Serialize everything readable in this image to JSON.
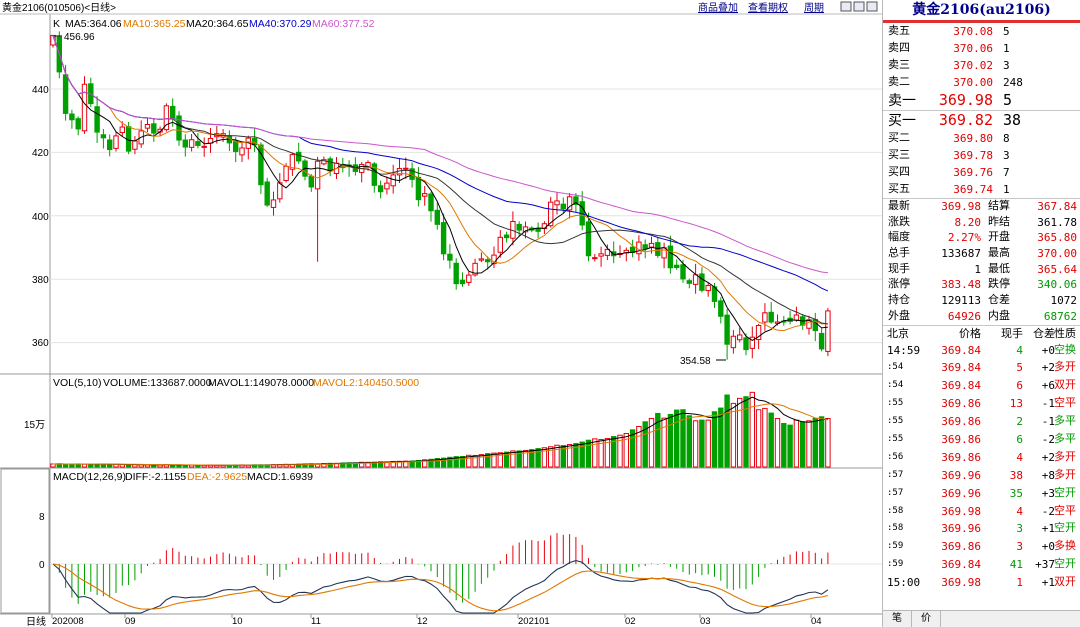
{
  "chart_header": {
    "title": "黄金2106",
    "code": "(010506)",
    "period": "<日线>",
    "links": [
      "商品叠加",
      "查看期权",
      "周期"
    ]
  },
  "ma_legend": [
    {
      "label": "MA5:364.06",
      "color": "#000000"
    },
    {
      "label": "MA10:365.25",
      "color": "#e07800"
    },
    {
      "label": "MA20:364.65",
      "color": "#000000"
    },
    {
      "label": "MA40:370.29",
      "color": "#0000cc"
    },
    {
      "label": "MA60:377.52",
      "color": "#cc55cc"
    }
  ],
  "price_pane": {
    "y_ticks": [
      "440",
      "420",
      "400",
      "380",
      "360"
    ],
    "high_label": "456.96",
    "low_label": "354.58"
  },
  "vol_pane": {
    "legend_vol": "VOL(5,10)",
    "legend_volume": "VOLUME:133687.0000",
    "legend_mavol1": "MAVOL1:149078.0000",
    "legend_mavol2": "MAVOL2:140450.5000",
    "y_tick": "15万"
  },
  "macd_pane": {
    "legend_macd": "MACD(12,26,9)",
    "legend_diff": "DIFF:-2.1155",
    "legend_dea": "DEA:-2.9625",
    "legend_hist": "MACD:1.6939",
    "y_ticks": [
      "8",
      "0"
    ]
  },
  "x_axis": {
    "period_label": "日线",
    "labels": [
      "202008",
      "09",
      "10",
      "11",
      "12",
      "202101",
      "02",
      "03",
      "04"
    ]
  },
  "quote": {
    "title": "黄金2106(au2106)",
    "asks": [
      {
        "label": "卖五",
        "price": "370.08",
        "vol": "5"
      },
      {
        "label": "卖四",
        "price": "370.06",
        "vol": "1"
      },
      {
        "label": "卖三",
        "price": "370.02",
        "vol": "3"
      },
      {
        "label": "卖二",
        "price": "370.00",
        "vol": "248"
      }
    ],
    "ask1": {
      "label": "卖一",
      "price": "369.98",
      "vol": "5"
    },
    "bid1": {
      "label": "买一",
      "price": "369.82",
      "vol": "38"
    },
    "bids": [
      {
        "label": "买二",
        "price": "369.80",
        "vol": "8"
      },
      {
        "label": "买三",
        "price": "369.78",
        "vol": "3"
      },
      {
        "label": "买四",
        "price": "369.76",
        "vol": "7"
      },
      {
        "label": "买五",
        "price": "369.74",
        "vol": "1"
      }
    ],
    "stats": [
      {
        "l1": "最新",
        "v1": "369.98",
        "c1": "red",
        "l2": "结算",
        "v2": "367.84",
        "c2": "red"
      },
      {
        "l1": "涨跌",
        "v1": "8.20",
        "c1": "red",
        "l2": "昨结",
        "v2": "361.78",
        "c2": "blk"
      },
      {
        "l1": "幅度",
        "v1": "2.27%",
        "c1": "red",
        "l2": "开盘",
        "v2": "365.80",
        "c2": "red"
      },
      {
        "l1": "总手",
        "v1": "133687",
        "c1": "blk",
        "l2": "最高",
        "v2": "370.00",
        "c2": "red"
      },
      {
        "l1": "现手",
        "v1": "1",
        "c1": "blk",
        "l2": "最低",
        "v2": "365.64",
        "c2": "red"
      },
      {
        "l1": "涨停",
        "v1": "383.48",
        "c1": "red",
        "l2": "跌停",
        "v2": "340.06",
        "c2": "green"
      },
      {
        "l1": "持仓",
        "v1": "129113",
        "c1": "blk",
        "l2": "仓差",
        "v2": "1072",
        "c2": "blk"
      },
      {
        "l1": "外盘",
        "v1": "64926",
        "c1": "red",
        "l2": "内盘",
        "v2": "68762",
        "c2": "green"
      }
    ],
    "tick_header": [
      "北京",
      "价格",
      "现手",
      "仓差",
      "性质"
    ],
    "ticks": [
      {
        "t": "14:59",
        "p": "369.84",
        "v": "4",
        "vc": "green",
        "d": "+0",
        "n": "空换",
        "nc": "green"
      },
      {
        "t": ":54",
        "p": "369.84",
        "v": "5",
        "vc": "red",
        "d": "+2",
        "n": "多开",
        "nc": "red"
      },
      {
        "t": ":54",
        "p": "369.84",
        "v": "6",
        "vc": "red",
        "d": "+6",
        "n": "双开",
        "nc": "red"
      },
      {
        "t": ":55",
        "p": "369.86",
        "v": "13",
        "vc": "red",
        "d": "-1",
        "n": "空平",
        "nc": "red"
      },
      {
        "t": ":55",
        "p": "369.86",
        "v": "2",
        "vc": "green",
        "d": "-1",
        "n": "多平",
        "nc": "green"
      },
      {
        "t": ":55",
        "p": "369.86",
        "v": "6",
        "vc": "green",
        "d": "-2",
        "n": "多平",
        "nc": "green"
      },
      {
        "t": ":56",
        "p": "369.86",
        "v": "4",
        "vc": "red",
        "d": "+2",
        "n": "多开",
        "nc": "red"
      },
      {
        "t": ":57",
        "p": "369.96",
        "v": "38",
        "vc": "red",
        "d": "+8",
        "n": "多开",
        "nc": "red"
      },
      {
        "t": ":57",
        "p": "369.96",
        "v": "35",
        "vc": "green",
        "d": "+3",
        "n": "空开",
        "nc": "green"
      },
      {
        "t": ":58",
        "p": "369.98",
        "v": "4",
        "vc": "red",
        "d": "-2",
        "n": "空平",
        "nc": "red"
      },
      {
        "t": ":58",
        "p": "369.96",
        "v": "3",
        "vc": "green",
        "d": "+1",
        "n": "空开",
        "nc": "green"
      },
      {
        "t": ":59",
        "p": "369.86",
        "v": "3",
        "vc": "red",
        "d": "+0",
        "n": "多换",
        "nc": "red"
      },
      {
        "t": ":59",
        "p": "369.84",
        "v": "41",
        "vc": "green",
        "d": "+37",
        "n": "空开",
        "nc": "green"
      },
      {
        "t": "15:00",
        "p": "369.98",
        "v": "1",
        "vc": "red",
        "d": "+1",
        "n": "双开",
        "nc": "red"
      }
    ],
    "bottom_tabs": [
      "笔",
      "价"
    ]
  },
  "chart_data": {
    "type": "candlestick",
    "title": "黄金2106",
    "ylim": [
      350,
      460
    ],
    "series_price": [
      456.9,
      445.4,
      432.3,
      430.3,
      427.4,
      441.5,
      435.4,
      426.4,
      424.6,
      420.9,
      425.2,
      428.0,
      420.4,
      423.6,
      426.8,
      428.8,
      426.1,
      427.3,
      434.7,
      430.5,
      423.9,
      421.7,
      424.0,
      422.2,
      421.9,
      424.4,
      425.9,
      425.9,
      423.0,
      420.3,
      421.4,
      424.5,
      422.4,
      409.8,
      403.4,
      405.0,
      410.4,
      415.6,
      419.3,
      417.3,
      412.5,
      409.1,
      417.2,
      417.7,
      414.2,
      416.6,
      415.5,
      415.6,
      414.0,
      416.2,
      416.8,
      409.6,
      407.6,
      410.3,
      412.9,
      414.9,
      415.0,
      411.5,
      405.1,
      407.0,
      401.6,
      397.3,
      388.0,
      386.0,
      378.6,
      378.6,
      381.3,
      385.0,
      386.4,
      385.5,
      387.6,
      393.2,
      393.1,
      398.2,
      395.5,
      396.5,
      395.5,
      395.1,
      397.5,
      404.3,
      404.7,
      402.2,
      406.0,
      403.6,
      397.1,
      387.4,
      386.8,
      388.0,
      389.4,
      387.4,
      388.1,
      389.1,
      388.4,
      391.7,
      389.6,
      391.3,
      387.5,
      389.9,
      383.6,
      383.7,
      380.1,
      378.7,
      381.4,
      376.5,
      378.0,
      373.0,
      368.3,
      359.5,
      362.0,
      362.4,
      357.8,
      361.7,
      365.4,
      369.4,
      366.5,
      366.5,
      366.7,
      366.7,
      368.7,
      365.5,
      367.2,
      363.8,
      358.0,
      370.0
    ],
    "series_volume": [
      9000,
      9400,
      8500,
      9000,
      9200,
      8200,
      8800,
      8600,
      8000,
      7700,
      7900,
      7200,
      7100,
      6900,
      6700,
      6800,
      6200,
      6000,
      6600,
      5900,
      6100,
      5600,
      5800,
      5200,
      5000,
      5500,
      5100,
      5000,
      4800,
      5200,
      6000,
      5200,
      6300,
      6300,
      6500,
      7000,
      7500,
      8000,
      7800,
      8300,
      9000,
      9500,
      9200,
      10400,
      11000,
      11000,
      12000,
      12500,
      12500,
      14000,
      14000,
      14500,
      15500,
      15000,
      16500,
      17000,
      17500,
      18000,
      19500,
      21500,
      23000,
      25500,
      26500,
      29000,
      31000,
      31500,
      35000,
      34500,
      37000,
      40000,
      41500,
      42500,
      44500,
      48000,
      48000,
      49500,
      52000,
      55000,
      57500,
      60500,
      65000,
      64000,
      67000,
      70000,
      74500,
      80000,
      84000,
      82000,
      85000,
      91000,
      95000,
      100000,
      111000,
      121000,
      135000,
      145000,
      160000,
      146000,
      157000,
      170000,
      171000,
      153000,
      138000,
      140000,
      140000,
      165000,
      176000,
      215000,
      190000,
      205000,
      210000,
      223000,
      171000,
      175000,
      161000,
      145000,
      130000,
      125000,
      140000,
      135000,
      138000,
      145000,
      150000,
      145000
    ]
  }
}
